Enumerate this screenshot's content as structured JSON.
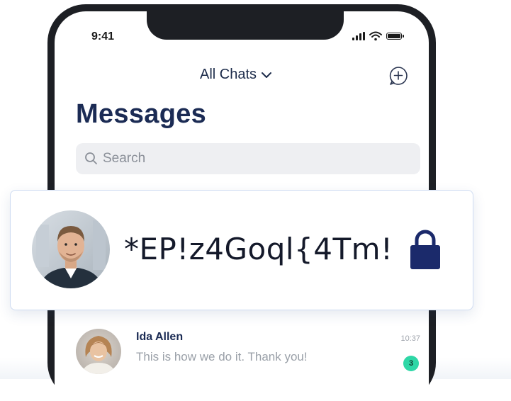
{
  "status_bar": {
    "time": "9:41"
  },
  "header": {
    "filter_label": "All Chats"
  },
  "title": "Messages",
  "search": {
    "placeholder": "Search"
  },
  "featured": {
    "password_text": "*EP!z4Goql{4Tm!"
  },
  "chats": [
    {
      "name": "Ida Allen",
      "message": "This is how we do it. Thank you!",
      "time": "10:37",
      "unread": "3"
    }
  ],
  "colors": {
    "navy": "#1b2b54",
    "lock": "#1b2a6b",
    "badge": "#2ed7a6",
    "search_bg": "#eeeff2",
    "phone_frame": "#1d1f24"
  },
  "icons": [
    "chevron-down-icon",
    "compose-icon",
    "search-icon",
    "lock-icon",
    "signal-icon",
    "wifi-icon",
    "battery-icon"
  ]
}
